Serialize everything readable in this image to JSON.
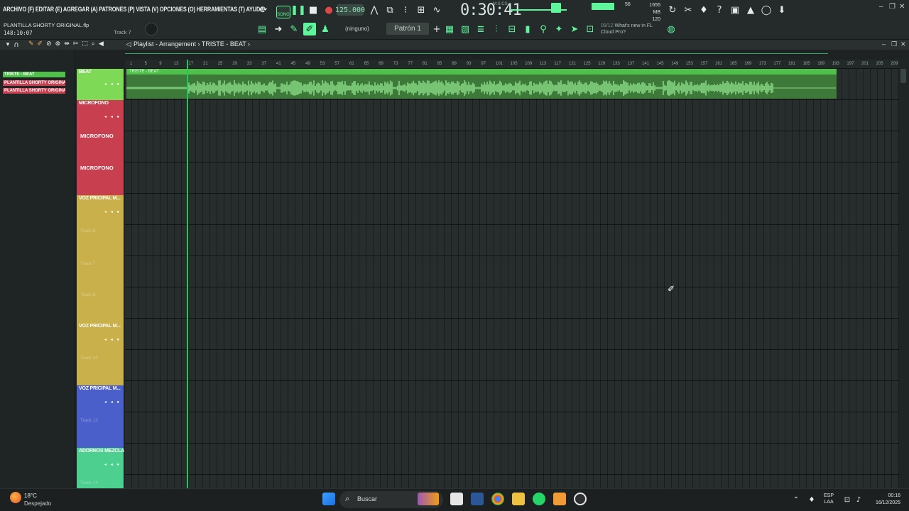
{
  "menubar": "ARCHIVO (F) EDITAR (E) AGREGAR (A) PATRONES (P) VISTA (V) OPCIONES (O) HERRAMIENTAS (T) AYUDA",
  "transport": {
    "mode": "SONG",
    "tempo": "125.000",
    "time": "0:30:41",
    "time_label": "M:S:CS"
  },
  "monitor": {
    "cpu": "56",
    "memory_top": "1655 MB",
    "memory_bottom": "120"
  },
  "project": {
    "name": "PLANTILLA SHORTY ORIGINAL.flp",
    "time": "148:10:07",
    "track_hint": "Track 7"
  },
  "toolbar2": {
    "snap": "(ninguno)",
    "pattern": "Patrón 1"
  },
  "news": {
    "date": "09/12",
    "line1": "What's new in FL",
    "line2": "Cloud Pro?"
  },
  "playlist": {
    "title": "Playlist - Arrangement › TRISTE - BEAT ›",
    "clip_name": "TRISTE - BEAT",
    "ruler": [
      "1",
      "5",
      "9",
      "13",
      "17",
      "21",
      "25",
      "29",
      "33",
      "37",
      "41",
      "45",
      "49",
      "53",
      "57",
      "61",
      "65",
      "69",
      "73",
      "77",
      "81",
      "85",
      "89",
      "93",
      "97",
      "101",
      "105",
      "109",
      "113",
      "117",
      "121",
      "125",
      "129",
      "133",
      "137",
      "141",
      "145",
      "149",
      "153",
      "157",
      "161",
      "165",
      "169",
      "173",
      "177",
      "181",
      "185",
      "189",
      "193",
      "197",
      "201",
      "205",
      "209"
    ]
  },
  "browser": {
    "items": [
      "TRISTE - BEAT",
      "PLANTILLA SHORTY ORIGINA",
      "PLANTILLA SHORTY ORIGINA"
    ]
  },
  "tracks": {
    "beat": {
      "name": "BEAT",
      "color": "#7ed957"
    },
    "microfono": {
      "name": "MICROFONO",
      "label1": "MICROFONO",
      "label2": "MICROFONO",
      "color": "#c8404f"
    },
    "voz1": {
      "name": "VOZ PRICIPAL M...",
      "sub1": "Track 6",
      "sub2": "Track 7",
      "sub3": "Track 8",
      "color": "#c9b04a"
    },
    "voz2": {
      "name": "VOZ PRICIPAL M...",
      "sub1": "Track 10",
      "color": "#c9b04a"
    },
    "voz3": {
      "name": "VOZ PRICIPAL M...",
      "sub1": "Track 12",
      "color": "#4a5fc9"
    },
    "adornos": {
      "name": "ADORNOS MEZCLA",
      "sub1": "Track 14",
      "color": "#4ccf8f"
    }
  },
  "taskbar": {
    "temp": "18°C",
    "weather": "Despejado",
    "search": "Buscar",
    "lang_top": "ESP",
    "lang_bottom": "LAA",
    "time": "00:16",
    "date": "16/12/2025"
  }
}
